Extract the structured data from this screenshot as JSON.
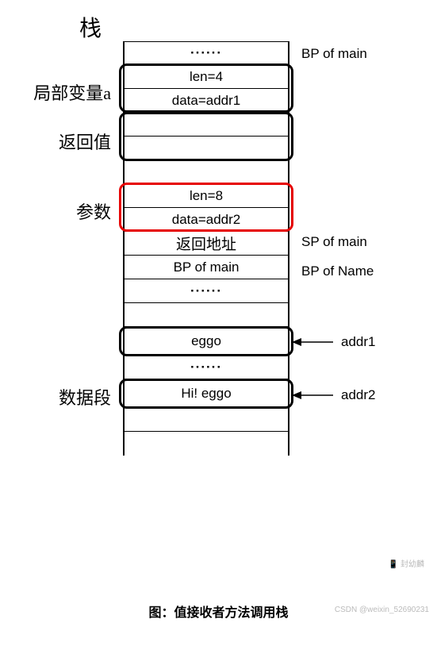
{
  "title_stack": "栈",
  "rows": {
    "r0": "······",
    "r1": "len=4",
    "r2": "data=addr1",
    "r3": "",
    "r4": "",
    "r5": "",
    "r6": "len=8",
    "r7": "data=addr2",
    "r8": "返回地址",
    "r9": "BP of main",
    "r10": "······",
    "r11": "",
    "r12": "eggo",
    "r13": "······",
    "r14": "Hi! eggo",
    "r15": "",
    "r16": ""
  },
  "left_labels": {
    "local_a": "局部变量a",
    "return_val": "返回值",
    "param": "参数",
    "data_seg": "数据段"
  },
  "right_labels": {
    "bp_main_top": "BP of main",
    "sp_main": "SP of main",
    "bp_name": "BP of Name",
    "addr1": "addr1",
    "addr2": "addr2"
  },
  "caption": "图：值接收者方法调用栈",
  "watermark1": "📱 封幼麟",
  "watermark2": "CSDN @weixin_52690231"
}
